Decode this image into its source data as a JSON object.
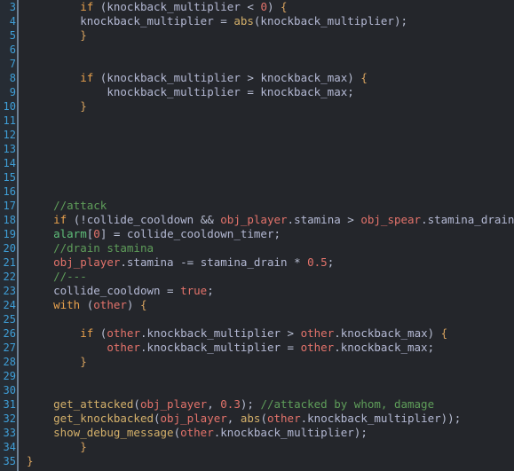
{
  "editor": {
    "language": "GameMaker Language (GML)",
    "theme": "dark",
    "first_line_number": 3,
    "last_line_number": 35,
    "colors": {
      "background": "#24262b",
      "gutter_background": "#262c34",
      "gutter_separator": "#6e8195",
      "line_number": "#3f9fd8",
      "default_text": "#b9bfd4",
      "keyword": "#e8a14d",
      "comment": "#5f9e5a",
      "number": "#e4736b",
      "function": "#d4b06a",
      "instance": "#e4736b",
      "builtin_variable": "#5fbf7a",
      "identifier": "#b4b9d4"
    }
  },
  "line_numbers": [
    3,
    4,
    5,
    6,
    7,
    8,
    9,
    10,
    11,
    12,
    13,
    14,
    15,
    16,
    17,
    18,
    19,
    20,
    21,
    22,
    23,
    24,
    25,
    26,
    27,
    28,
    29,
    30,
    31,
    32,
    33,
    34,
    35
  ],
  "lines": [
    {
      "n": 3,
      "text": "        if (knockback_multiplier < 0) {"
    },
    {
      "n": 4,
      "text": "        knockback_multiplier = abs(knockback_multiplier);"
    },
    {
      "n": 5,
      "text": "        }"
    },
    {
      "n": 6,
      "text": ""
    },
    {
      "n": 7,
      "text": ""
    },
    {
      "n": 8,
      "text": "        if (knockback_multiplier > knockback_max) {"
    },
    {
      "n": 9,
      "text": "            knockback_multiplier = knockback_max;"
    },
    {
      "n": 10,
      "text": "        }"
    },
    {
      "n": 11,
      "text": ""
    },
    {
      "n": 12,
      "text": ""
    },
    {
      "n": 13,
      "text": ""
    },
    {
      "n": 14,
      "text": ""
    },
    {
      "n": 15,
      "text": ""
    },
    {
      "n": 16,
      "text": ""
    },
    {
      "n": 17,
      "text": "    //attack"
    },
    {
      "n": 18,
      "text": "    if (!collide_cooldown && obj_player.stamina > obj_spear.stamina_drain) {"
    },
    {
      "n": 19,
      "text": "    alarm[0] = collide_cooldown_timer;"
    },
    {
      "n": 20,
      "text": "    //drain stamina"
    },
    {
      "n": 21,
      "text": "    obj_player.stamina -= stamina_drain * 0.5;"
    },
    {
      "n": 22,
      "text": "    //---"
    },
    {
      "n": 23,
      "text": "    collide_cooldown = true;"
    },
    {
      "n": 24,
      "text": "    with (other) {"
    },
    {
      "n": 25,
      "text": ""
    },
    {
      "n": 26,
      "text": "        if (other.knockback_multiplier > other.knockback_max) {"
    },
    {
      "n": 27,
      "text": "            other.knockback_multiplier = other.knockback_max;"
    },
    {
      "n": 28,
      "text": "        }"
    },
    {
      "n": 29,
      "text": ""
    },
    {
      "n": 30,
      "text": ""
    },
    {
      "n": 31,
      "text": "    get_attacked(obj_player, 0.3); //attacked by whom, damage"
    },
    {
      "n": 32,
      "text": "    get_knockbacked(obj_player, abs(other.knockback_multiplier));"
    },
    {
      "n": 33,
      "text": "    show_debug_message(other.knockback_multiplier);"
    },
    {
      "n": 34,
      "text": "        }"
    },
    {
      "n": 35,
      "text": "}"
    }
  ],
  "tokens": {
    "3": [
      [
        8,
        "        "
      ],
      [
        "kw",
        "if"
      ],
      [
        "op",
        " ("
      ],
      [
        "id",
        "knockback_multiplier"
      ],
      [
        "op",
        " < "
      ],
      [
        "num",
        "0"
      ],
      [
        "op",
        ")"
      ],
      [
        "punc",
        " {"
      ]
    ],
    "4": [
      [
        8,
        "        "
      ],
      [
        "id",
        "knockback_multiplier"
      ],
      [
        "op",
        " = "
      ],
      [
        "fn",
        "abs"
      ],
      [
        "op",
        "("
      ],
      [
        "id",
        "knockback_multiplier"
      ],
      [
        "op",
        ");"
      ]
    ],
    "5": [
      [
        8,
        "        "
      ],
      [
        "punc",
        "}"
      ]
    ],
    "8": [
      [
        8,
        "        "
      ],
      [
        "kw",
        "if"
      ],
      [
        "op",
        " ("
      ],
      [
        "id",
        "knockback_multiplier"
      ],
      [
        "op",
        " > "
      ],
      [
        "id",
        "knockback_max"
      ],
      [
        "op",
        ")"
      ],
      [
        "punc",
        " {"
      ]
    ],
    "9": [
      [
        12,
        "            "
      ],
      [
        "id",
        "knockback_multiplier"
      ],
      [
        "op",
        " = "
      ],
      [
        "id",
        "knockback_max"
      ],
      [
        "op",
        ";"
      ]
    ],
    "10": [
      [
        8,
        "        "
      ],
      [
        "punc",
        "}"
      ]
    ],
    "17": [
      [
        4,
        "    "
      ],
      [
        "cmt",
        "//attack"
      ]
    ],
    "18": [
      [
        4,
        "    "
      ],
      [
        "kw",
        "if"
      ],
      [
        "op",
        " (!"
      ],
      [
        "id",
        "collide_cooldown"
      ],
      [
        "op",
        " && "
      ],
      [
        "obj",
        "obj_player"
      ],
      [
        "op",
        "."
      ],
      [
        "id",
        "stamina"
      ],
      [
        "op",
        " > "
      ],
      [
        "obj",
        "obj_spear"
      ],
      [
        "op",
        "."
      ],
      [
        "id",
        "stamina_drain"
      ],
      [
        "op",
        ")"
      ],
      [
        "punc",
        " {"
      ]
    ],
    "19": [
      [
        4,
        "    "
      ],
      [
        "bi",
        "alarm"
      ],
      [
        "op",
        "["
      ],
      [
        "num",
        "0"
      ],
      [
        "op",
        "] = "
      ],
      [
        "id",
        "collide_cooldown_timer"
      ],
      [
        "op",
        ";"
      ]
    ],
    "20": [
      [
        4,
        "    "
      ],
      [
        "cmt",
        "//drain stamina"
      ]
    ],
    "21": [
      [
        4,
        "    "
      ],
      [
        "obj",
        "obj_player"
      ],
      [
        "op",
        "."
      ],
      [
        "id",
        "stamina"
      ],
      [
        "op",
        " -= "
      ],
      [
        "id",
        "stamina_drain"
      ],
      [
        "op",
        " * "
      ],
      [
        "num",
        "0.5"
      ],
      [
        "op",
        ";"
      ]
    ],
    "22": [
      [
        4,
        "    "
      ],
      [
        "cmt",
        "//---"
      ]
    ],
    "23": [
      [
        4,
        "    "
      ],
      [
        "id",
        "collide_cooldown"
      ],
      [
        "op",
        " = "
      ],
      [
        "obj",
        "true"
      ],
      [
        "op",
        ";"
      ]
    ],
    "24": [
      [
        4,
        "    "
      ],
      [
        "kw",
        "with"
      ],
      [
        "op",
        " ("
      ],
      [
        "obj",
        "other"
      ],
      [
        "op",
        ")"
      ],
      [
        "punc",
        " {"
      ]
    ],
    "26": [
      [
        8,
        "        "
      ],
      [
        "kw",
        "if"
      ],
      [
        "op",
        " ("
      ],
      [
        "obj",
        "other"
      ],
      [
        "op",
        "."
      ],
      [
        "id",
        "knockback_multiplier"
      ],
      [
        "op",
        " > "
      ],
      [
        "obj",
        "other"
      ],
      [
        "op",
        "."
      ],
      [
        "id",
        "knockback_max"
      ],
      [
        "op",
        ")"
      ],
      [
        "punc",
        " {"
      ]
    ],
    "27": [
      [
        12,
        "            "
      ],
      [
        "obj",
        "other"
      ],
      [
        "op",
        "."
      ],
      [
        "id",
        "knockback_multiplier"
      ],
      [
        "op",
        " = "
      ],
      [
        "obj",
        "other"
      ],
      [
        "op",
        "."
      ],
      [
        "id",
        "knockback_max"
      ],
      [
        "op",
        ";"
      ]
    ],
    "28": [
      [
        8,
        "        "
      ],
      [
        "punc",
        "}"
      ]
    ],
    "31": [
      [
        4,
        "    "
      ],
      [
        "fn",
        "get_attacked"
      ],
      [
        "op",
        "("
      ],
      [
        "obj",
        "obj_player"
      ],
      [
        "op",
        ", "
      ],
      [
        "num",
        "0.3"
      ],
      [
        "op",
        "); "
      ],
      [
        "cmt",
        "//attacked by whom, damage"
      ]
    ],
    "32": [
      [
        4,
        "    "
      ],
      [
        "fn",
        "get_knockbacked"
      ],
      [
        "op",
        "("
      ],
      [
        "obj",
        "obj_player"
      ],
      [
        "op",
        ", "
      ],
      [
        "fn",
        "abs"
      ],
      [
        "op",
        "("
      ],
      [
        "obj",
        "other"
      ],
      [
        "op",
        "."
      ],
      [
        "id",
        "knockback_multiplier"
      ],
      [
        "op",
        "));"
      ]
    ],
    "33": [
      [
        4,
        "    "
      ],
      [
        "fn",
        "show_debug_message"
      ],
      [
        "op",
        "("
      ],
      [
        "obj",
        "other"
      ],
      [
        "op",
        "."
      ],
      [
        "id",
        "knockback_multiplier"
      ],
      [
        "op",
        ");"
      ]
    ],
    "34": [
      [
        8,
        "        "
      ],
      [
        "punc",
        "}"
      ]
    ],
    "35": [
      [
        "punc",
        "}"
      ]
    ]
  }
}
